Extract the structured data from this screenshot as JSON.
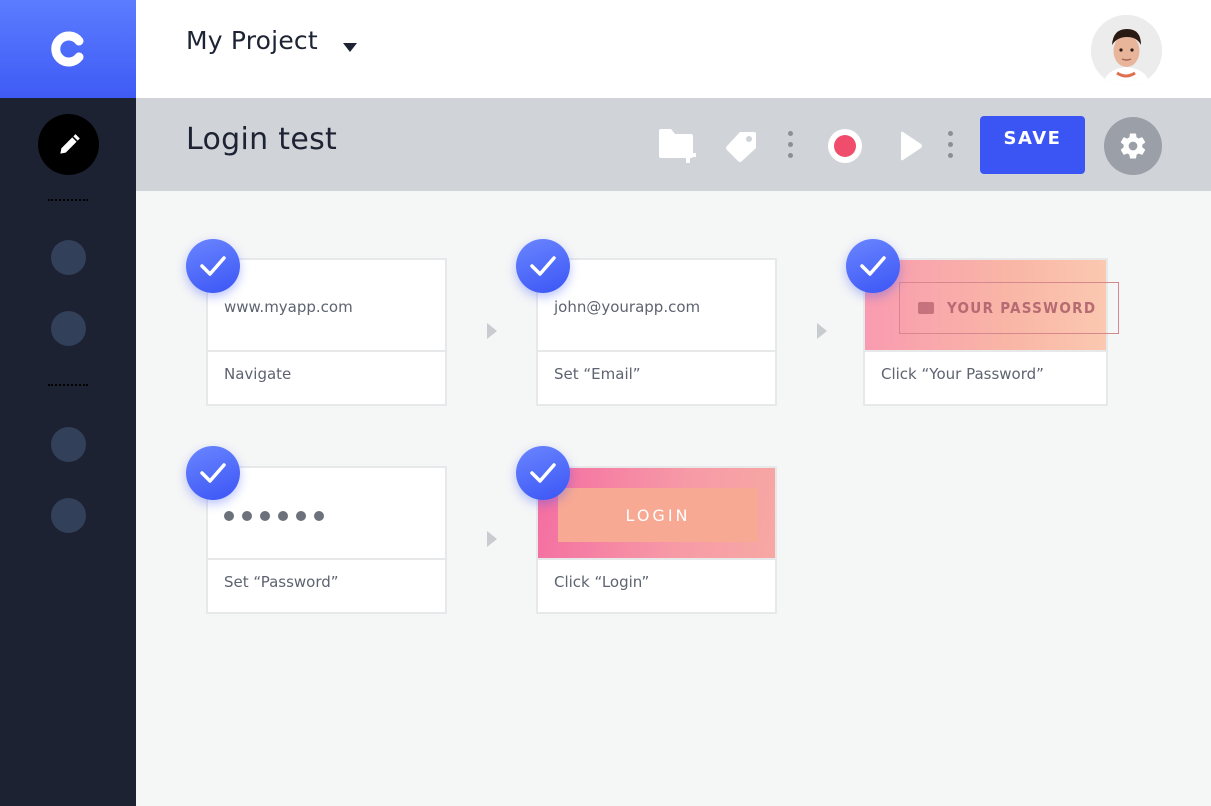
{
  "header": {
    "project_title": "My Project"
  },
  "toolbar": {
    "test_title": "Login test",
    "save_label": "SAVE"
  },
  "steps": [
    {
      "preview": "www.myapp.com",
      "label": "Navigate"
    },
    {
      "preview": "john@yourapp.com",
      "label": "Set “Email”"
    },
    {
      "preview": "YOUR PASSWORD",
      "label": "Click “Your Password”"
    },
    {
      "preview": "••••••",
      "label": "Set “Password”"
    },
    {
      "preview": "LOGIN",
      "label": "Click “Login”"
    }
  ],
  "colors": {
    "accent": "#3b55f5",
    "sidebar": "#1c2232",
    "record": "#ef4d6b"
  }
}
